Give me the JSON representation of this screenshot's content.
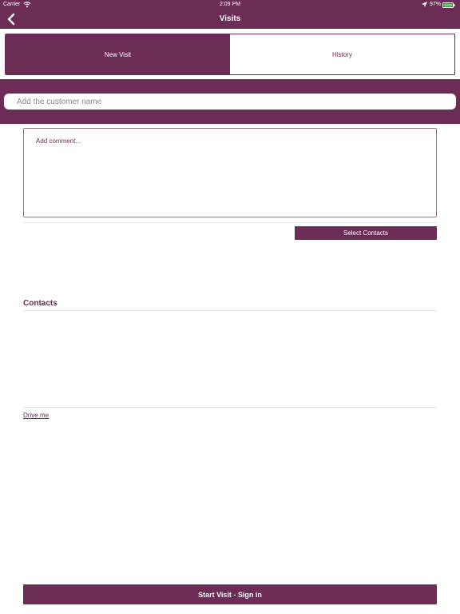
{
  "status_bar": {
    "carrier": "Carrier",
    "time": "2:09 PM",
    "battery": "97%"
  },
  "nav": {
    "title": "Visits",
    "back_icon": "chevron-left-icon"
  },
  "tabs": [
    {
      "label": "New Visit",
      "active": true
    },
    {
      "label": "History",
      "active": false
    }
  ],
  "form": {
    "customer_placeholder": "Add the customer name",
    "comment_placeholder": "Add comment...",
    "select_contacts_label": "Select Contacts",
    "contacts_heading": "Contacts",
    "drive_me_label": "Drive me",
    "start_visit_label": "Start Visit - Sign in"
  },
  "colors": {
    "brand": "#6b2c55",
    "battery": "#4cd964"
  }
}
